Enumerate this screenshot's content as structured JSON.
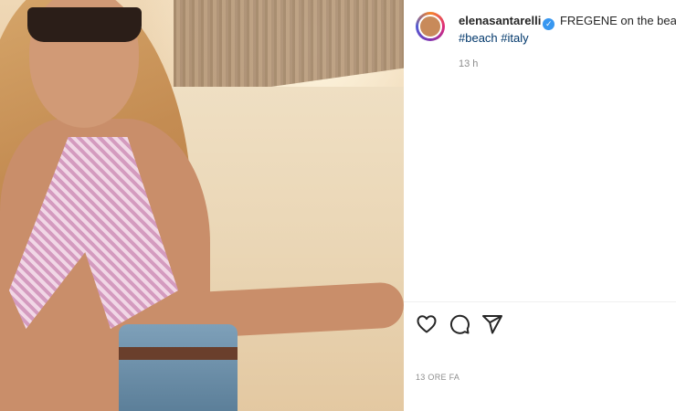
{
  "post": {
    "username": "elenasantarelli",
    "verified_mark": "✓",
    "caption_text": "FREGENE on the beach",
    "caption_tag_cut": "#",
    "hashtags": [
      "#beach",
      "#italy"
    ],
    "time_short": "13 h",
    "time_ago": "13 ORE FA"
  },
  "icons": {
    "like": "heart-icon",
    "comment": "comment-icon",
    "share": "send-icon"
  },
  "colors": {
    "link": "#00376b",
    "verified": "#3897f0",
    "muted": "#8e8e8e"
  }
}
